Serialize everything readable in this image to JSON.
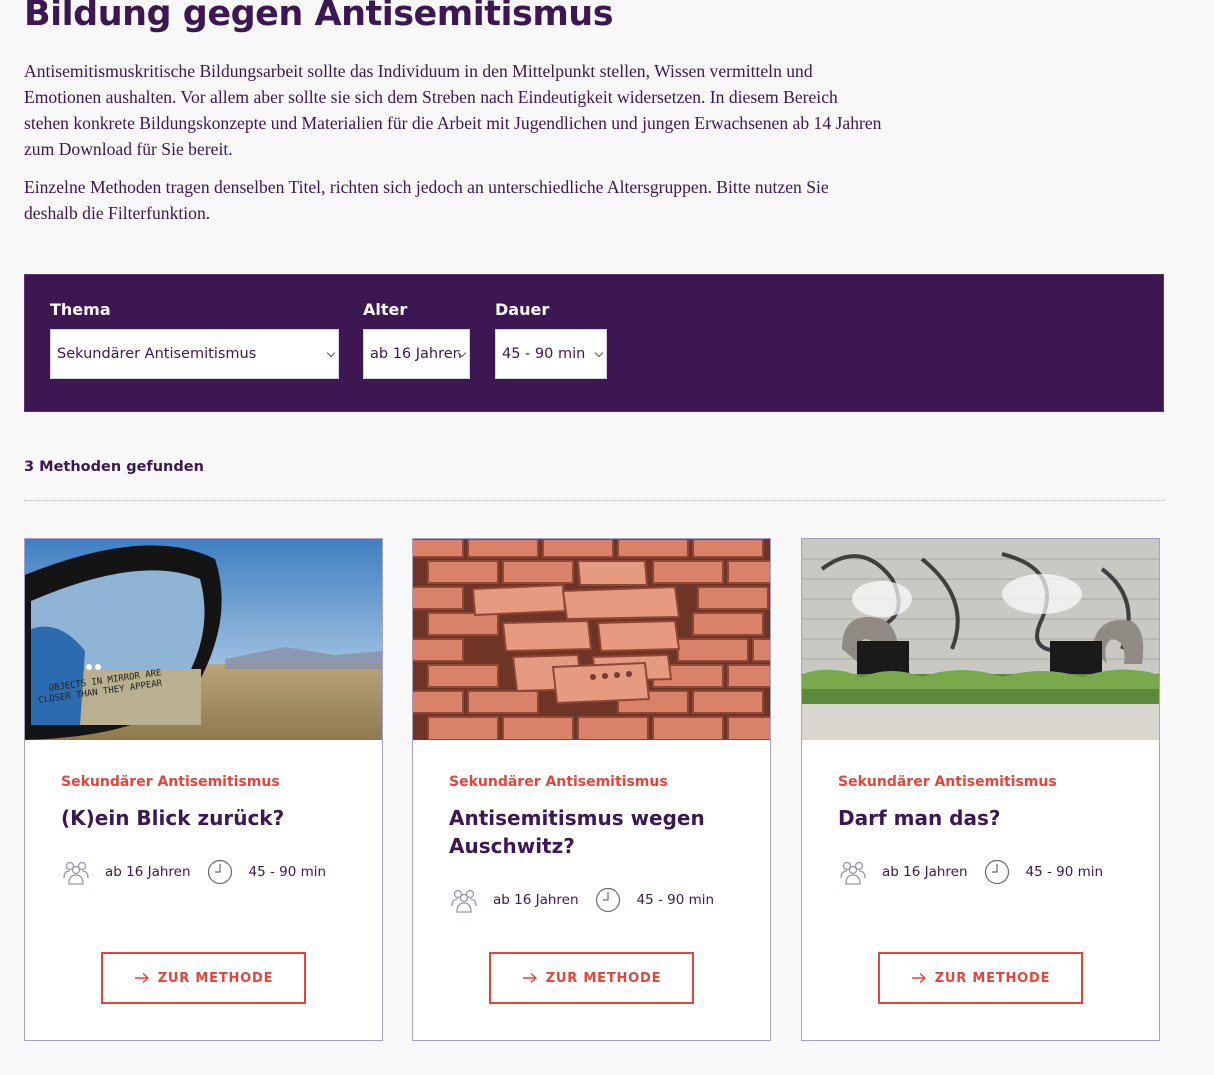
{
  "page": {
    "title": "Bildung gegen Antisemitismus",
    "intro_paragraphs": [
      "Antisemitismuskritische Bildungsarbeit sollte das Individuum in den Mittelpunkt stellen, Wissen vermitteln und Emotionen aushalten. Vor allem aber sollte sie sich dem Streben nach Eindeutigkeit widersetzen. In diesem Bereich stehen konkrete Bildungskonzepte und Materialien für die Arbeit mit Jugendlichen und jungen Erwachsenen ab 14 Jahren zum Download für Sie bereit.",
      "Einzelne Methoden tragen denselben Titel, richten sich jedoch an unterschiedliche Altersgruppen. Bitte nutzen Sie deshalb die Filterfunktion."
    ]
  },
  "filters": {
    "thema": {
      "label": "Thema",
      "value": "Sekundärer Antisemitismus"
    },
    "alter": {
      "label": "Alter",
      "value": "ab 16 Jahren"
    },
    "dauer": {
      "label": "Dauer",
      "value": "45 - 90 min"
    }
  },
  "results": {
    "count_text": "3 Methoden gefunden"
  },
  "cards": [
    {
      "category": "Sekundärer Antisemitismus",
      "title": "(K)ein Blick zurück?",
      "age": "ab 16 Jahren",
      "duration": "45 - 90 min",
      "button": "ZUR METHODE",
      "image_text": [
        "OBJECTS IN MIRROR ARE",
        "CLOSER THAN THEY APPEAR"
      ]
    },
    {
      "category": "Sekundärer Antisemitismus",
      "title": "Antisemitismus wegen Auschwitz?",
      "age": "ab 16 Jahren",
      "duration": "45 - 90 min",
      "button": "ZUR METHODE"
    },
    {
      "category": "Sekundärer Antisemitismus",
      "title": "Darf man das?",
      "age": "ab 16 Jahren",
      "duration": "45 - 90 min",
      "button": "ZUR METHODE"
    }
  ],
  "colors": {
    "brand_purple": "#3d1752",
    "accent_red": "#e2463a"
  },
  "icons": [
    "group-icon",
    "clock-icon",
    "arrow-right-icon",
    "chevron-down-icon"
  ]
}
